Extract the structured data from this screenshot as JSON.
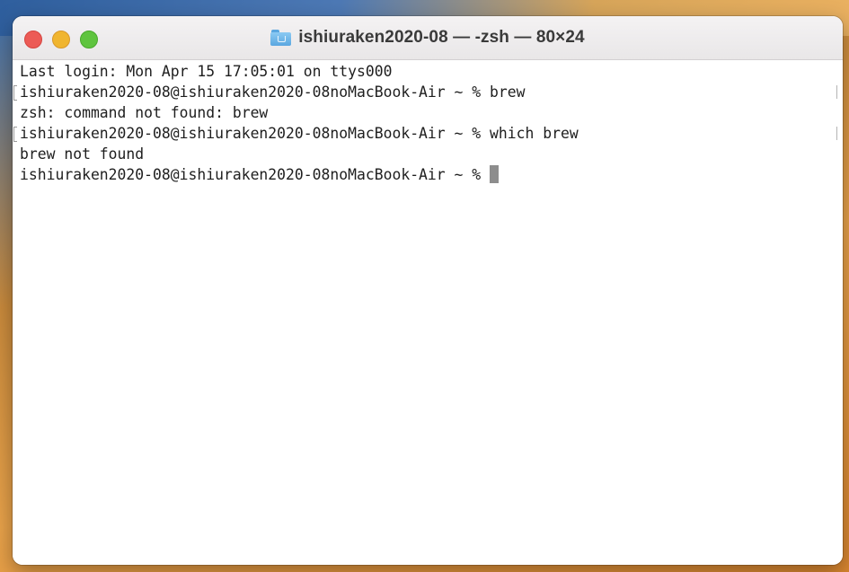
{
  "window": {
    "title": "ishiuraken2020-08 — -zsh — 80×24",
    "title_icon": "folder-home-icon"
  },
  "colors": {
    "close": "#ec5b56",
    "minimize": "#f0b52f",
    "zoom": "#5fc43f",
    "text": "#1e1e1e",
    "background": "#ffffff"
  },
  "terminal": {
    "lines": [
      "Last login: Mon Apr 15 17:05:01 on ttys000",
      "ishiuraken2020-08@ishiuraken2020-08noMacBook-Air ~ % brew",
      "zsh: command not found: brew",
      "ishiuraken2020-08@ishiuraken2020-08noMacBook-Air ~ % which brew",
      "brew not found",
      "ishiuraken2020-08@ishiuraken2020-08noMacBook-Air ~ % "
    ]
  }
}
